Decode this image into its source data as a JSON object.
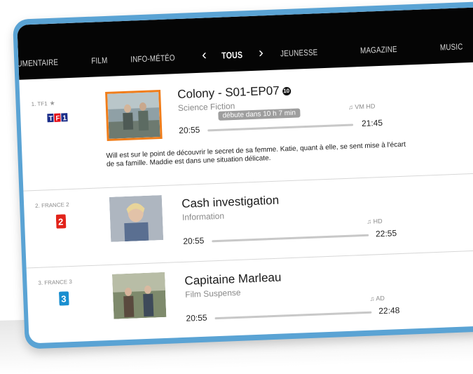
{
  "nav": {
    "items": [
      "UMENTAIRE",
      "FILM",
      "INFO-MÉTÉO",
      "TOUS",
      "JEUNESSE",
      "MAGAZINE",
      "MUSIC"
    ],
    "prev_arrow": "‹",
    "next_arrow": "›"
  },
  "programs": [
    {
      "channel_label": "1. TF1",
      "logo_text": "TF1",
      "title": "Colony - S01-EP07",
      "rating_badge": "10",
      "genre": "Science Fiction",
      "tags": "VM  HD",
      "tooltip": "débute dans 10 h 7 min",
      "start": "20:55",
      "end": "21:45",
      "progress": 0,
      "description": "Will est sur le point de découvrir le secret de sa femme. Katie, quant à elle, se sent mise à l'écart de sa famille. Maddie est dans une situation délicate."
    },
    {
      "channel_label": "2. FRANCE 2",
      "logo_text": "2",
      "title": "Cash investigation",
      "genre": "Information",
      "tags": "HD",
      "start": "20:55",
      "end": "22:55",
      "progress": 0
    },
    {
      "channel_label": "3. FRANCE 3",
      "logo_text": "3",
      "title": "Capitaine Marleau",
      "genre": "Film Suspense",
      "tags": "AD",
      "start": "20:55",
      "end": "22:48",
      "progress": 0
    }
  ],
  "colors": {
    "frame": "#5aa3d4",
    "navbar": "#050505",
    "highlight_border": "#f07d1a",
    "tf1_red": "#e30613",
    "tf1_blue": "#1b2e8a",
    "france2_red": "#e2231a",
    "france3_blue": "#1a8fd0"
  }
}
